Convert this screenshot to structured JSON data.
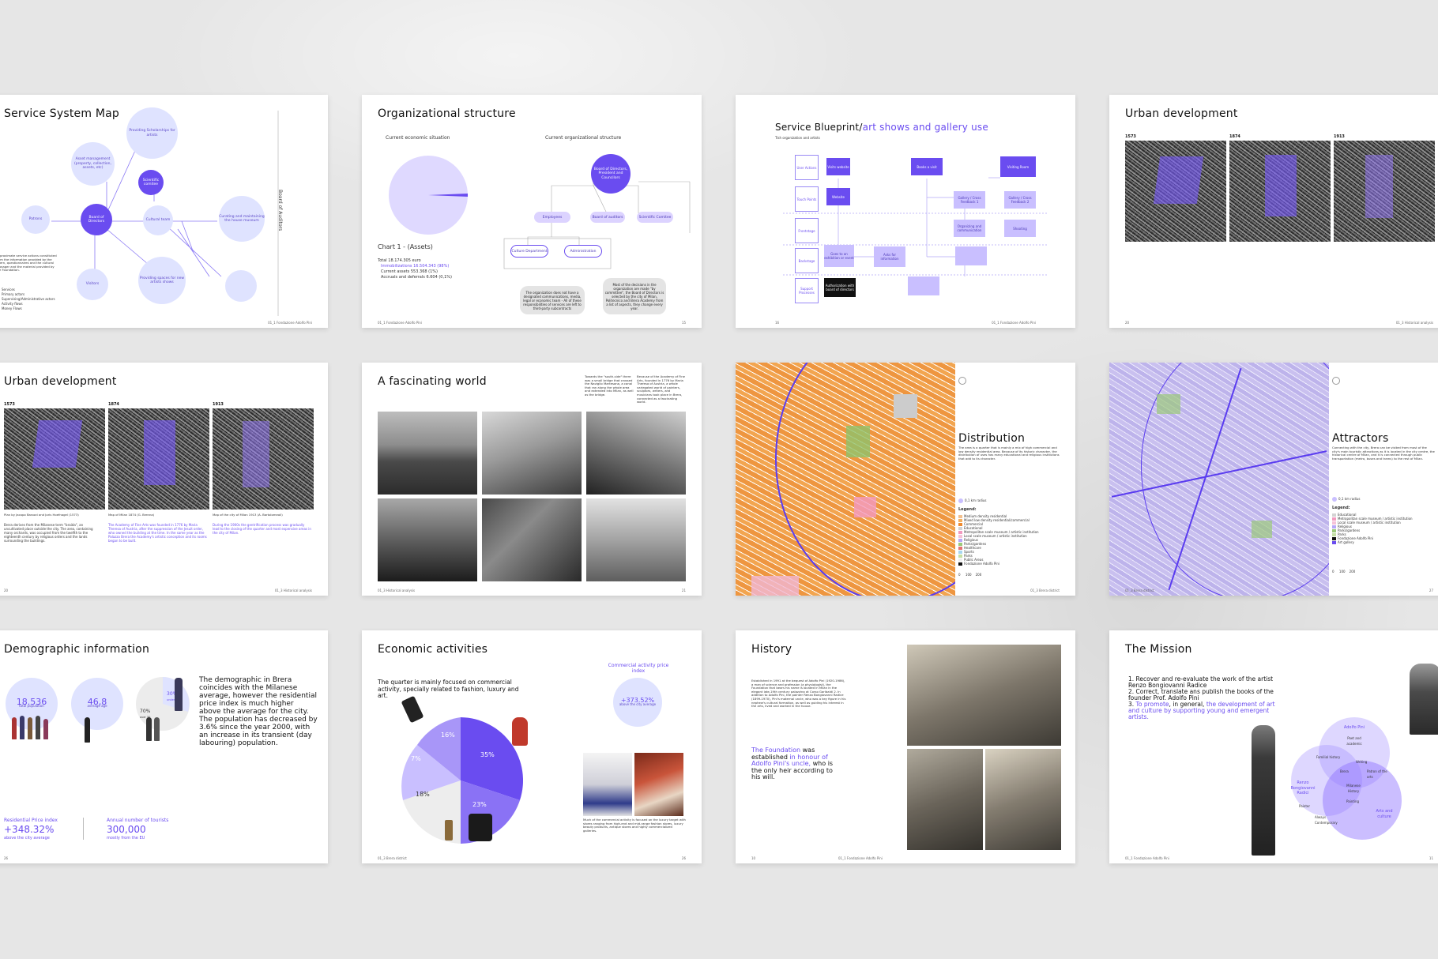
{
  "pages": {
    "p1": {
      "title": "Service System Map",
      "nodes": {
        "scholarships": "Providing Scholarships for artists",
        "asset": "Asset management (property, collection, assets, etc)",
        "scientific": "Scientific comitee",
        "patrons": "Patrons",
        "board": "Board of Directors",
        "cultural": "Cultural team",
        "curating": "Curating and maintaining the house museum",
        "visitors": "Visitors",
        "spaces": "Providing spaces for new artists shows",
        "admin": "Administration",
        "auditors": "Board of Auditors",
        "auditors_sub": "Finance Supervision"
      },
      "edges": [
        "Scholarship",
        "Management",
        "Bank and dividends",
        "Donations",
        "Donations",
        "Salaries",
        "Supervision",
        "Providing information"
      ],
      "desc": "Approximate service actions constituted from the information provided by the intern, questionnaires and the cultural manager and the material provided by the Foundation.",
      "legend": [
        "Services",
        "Primary actors",
        "Supervising/Administrative actors",
        "Activity flows",
        "Money Flows"
      ],
      "footer_left": "14",
      "footer_right": "01_1 Fondazione Adolfo Pini"
    },
    "p2": {
      "title": "Organizational structure",
      "sub_left": "Current economic situation",
      "sub_right": "Current organizational structure",
      "chart_label": "Chart 1 - (Assets)",
      "totals": [
        "Total 18.174.305 euro",
        "Immobilizations 16.504.343 (98%)",
        "Current assets 553.368 (1%)",
        "Accruals and deferrals 6.604 (0,1%)"
      ],
      "org": {
        "board": "Board of Directors, President and Councilors",
        "employees": "Employees",
        "auditors": "Board of auditors",
        "scientific": "Scientific Comitee",
        "culture": "Culture Department",
        "administration": "Administration"
      },
      "note1": "The organization does not have a designated communications, media, legal or economic team - All of these responsibilities of services are left to third-party subcontracts",
      "note2": "Most of the decisions in the organization are made \"by committee\", the Board of Directors is selected by the city of Milan, Politecnico and Brera Academy from a list of aspects, they change every year.",
      "footer_left": "01_1 Fondazione Adolfo Pini",
      "footer_right": "15"
    },
    "p3": {
      "title_plain": "Service Blueprint/",
      "title_accent": "art shows and gallery use",
      "sub": "Tish organization and artists",
      "rows": [
        "User Actions",
        "Touch Points",
        "Frontstage",
        "Backstage",
        "Support Processes"
      ],
      "boxes": [
        "Visits website",
        "Website",
        "Goes to an exhibition or event",
        "Asks for information",
        "Books a visit",
        "Authorization with board of directors",
        "Gallery / Cross Feedback 1",
        "Gallery / Cross Feedback 2",
        "Organizing and communication",
        "Shooting",
        "Visiting Room"
      ],
      "footer_left": "16",
      "footer_right": "01_1 Fondazione Adolfo Pini"
    },
    "p4": {
      "title": "Urban development",
      "years": [
        "1573",
        "1874",
        "1913"
      ],
      "footer_left": "20",
      "footer_right": "01_3 Historical analysis"
    },
    "p5": {
      "title": "Urban development",
      "years": [
        "1573",
        "1874",
        "1913"
      ],
      "captions": [
        "Plan by Jacopo Barozzi and Joris Hoefnagel (1573)",
        "Map of Milan 1874 (G. Brenna)",
        "Map of the city of Milan 1913 (A. Bartolomeoli)"
      ],
      "text1": "Brera derives from the Milanese term \"braida\", an uncultivated place outside the city. The area, containing many orchards, was occupied from the twelfth to the eighteenth century by religious orders and the lands surrounding the buildings.",
      "text2": "The Academy of Fine Arts was founded in 1776 by Maria Theresa of Austria, after the suppression of the Jesuit order, who owned the building at the time. In the same year as the Palazzo Brera the Academy's artistic conception and its rooms began to be built.",
      "text3": "During the 1900s the gentrification process was gradually lead to the closing of the quarter and most expensive areas in the city of Milan.",
      "footer_left": "20",
      "footer_right": "01_3 Historical analysis"
    },
    "p6": {
      "title": "A fascinating world",
      "text1": "Towards the \"south-side\" there was a small bridge that crossed the Naviglio Martesana, a canal that ran along the whole area and extended into Milan, as well as the bridge.",
      "text2": "Because of the Academy of Fine Arts, founded in 1776 by Maria Theresa of Austria, a whole variegated world of painters, sculptors, writers, and musicians took place in Brera, connected as a fascinating world.",
      "footer_left": "01_3 Historical analysis",
      "footer_right": "21"
    },
    "p7": {
      "title": "Distribution",
      "text": "The area is a quarter that is mainly a mix of high commercial and low density residential area. Because of its historic character, the distribution of uses has many educational and religious institutions that add to its character.",
      "key": "0,1 km radius",
      "legend_title": "Legend:",
      "legend": [
        "Medium density residential",
        "Mixed low density residential/commercial",
        "Commercial",
        "Educational",
        "Metropolitan scale museum / artistic institution",
        "Local scale museum / artistic institution",
        "Religious",
        "Parks/gardens",
        "Healthcare",
        "Sports",
        "Parks",
        "Public Areas",
        "Fondazione Adolfo Pini"
      ],
      "scale": [
        "0",
        "100",
        "200"
      ],
      "footer_right": "01_3 Brera district"
    },
    "p8": {
      "title": "Attractors",
      "text": "Connecting with the city, Brera can be visited from most of the city's main touristic attractions as it is located in the city centre, the historical centre of Milan, and it is connected through public transportation (metro, buses and trams) to the rest of Milan.",
      "key": "0,1 km radius",
      "legend_title": "Legend:",
      "legend": [
        "Educational",
        "Metropolitan scale museum / artistic institution",
        "Local scale museum / artistic institution",
        "Religious",
        "Parks/gardens",
        "Parks",
        "Fondazione Adolfo Pini",
        "Art gallery"
      ],
      "scale": [
        "0",
        "100",
        "200"
      ],
      "footer_left": "01_3 Brera district",
      "footer_right": "27"
    },
    "p9": {
      "title": "Demographic information",
      "stat1_value": "18.536",
      "stat1_label": "total population",
      "stat2_value": "46,8",
      "stat2_label": "average age",
      "stat3_a": "30%",
      "stat3_a_label": "under 30",
      "stat3_b": "70%",
      "stat3_b_label": "over 30",
      "body": "The demographic in Brera coincides with the Milanese average, however the residential price index is much higher above the average for the city. The population has decreased by 3.6% since the year 2000, with an increase in its transient (day labouring) population.",
      "rpi_label": "Residential Price index",
      "rpi_value": "+348.32%",
      "rpi_sub": "above the city average",
      "tourists_label": "Annual number of tourists",
      "tourists_value": "300,000",
      "tourists_sub": "mostly from the EU",
      "footer_left": "26"
    },
    "p10": {
      "title": "Economic activities",
      "body": "The quarter is mainly focused on commercial activity, specially related to fashion, luxury and art.",
      "index_label": "Commercial activity price index",
      "index_value": "+373.52%",
      "index_sub": "above the city average",
      "caption": "Much of the commercial activity is focused on the luxury target with stores ranging from high-end and mid-range fashion stores, luxury beauty products, antique stores and highly commercialized galleries.",
      "footer_left": "01_3 Brera district",
      "footer_right": "26"
    },
    "p11": {
      "title": "History",
      "body": "Established in 1991 at the bequest of Adolfo Pini (1920-1986), a man of science and profession (a physiologist), the Foundation that bears his name is located in Milan in the elegant late-19th century palazzina at Corso Garibaldi 2. In addition to Adolfo Pini, the painter Renzo Bongiovanni Radice (1899-1970), Pini's maternal uncle, who was a key figure in his nephew's cultural formation, as well as guiding his interest in the arts, lived and worked in the house.",
      "accent1": "The Foundation",
      "mid1": " was established ",
      "accent2": "in honour of Adolfo Pini's uncle,",
      "tail": " who is the only heir according to his will.",
      "footer_left": "10",
      "footer_right": "01_1 Fondazione Adolfo Pini"
    },
    "p12": {
      "title": "The Mission",
      "items": [
        "Recover and re-evaluate the work of the artist Renzo Bongiovanni Radice",
        "Correct, translate ans publish the books of the founder Prof. Adolfo Pini"
      ],
      "item3_a": "To promote",
      "item3_b": ", in general, ",
      "item3_c": "the development of art and culture by supporting young and emergent artists.",
      "venn": {
        "adolfo": "Adolfo Pini",
        "adolfo_sub": "Poet and academic",
        "renzo": "Renzo Bongiovanni Radici",
        "arts": "Arts and culture",
        "familial": "Familial history",
        "writing": "Writing",
        "brera": "Brera",
        "patron": "Patron of the arts",
        "milanese": "Milanese History",
        "painting": "Painting",
        "painter": "Painter",
        "always": "Always Contemporary"
      },
      "footer_left": "01_1 Fondazione Adolfo Pini",
      "footer_right": "11"
    }
  },
  "colors": {
    "accent": "#6a4cf0",
    "light": "#dfe3ff",
    "background": "#e6e6e6"
  }
}
